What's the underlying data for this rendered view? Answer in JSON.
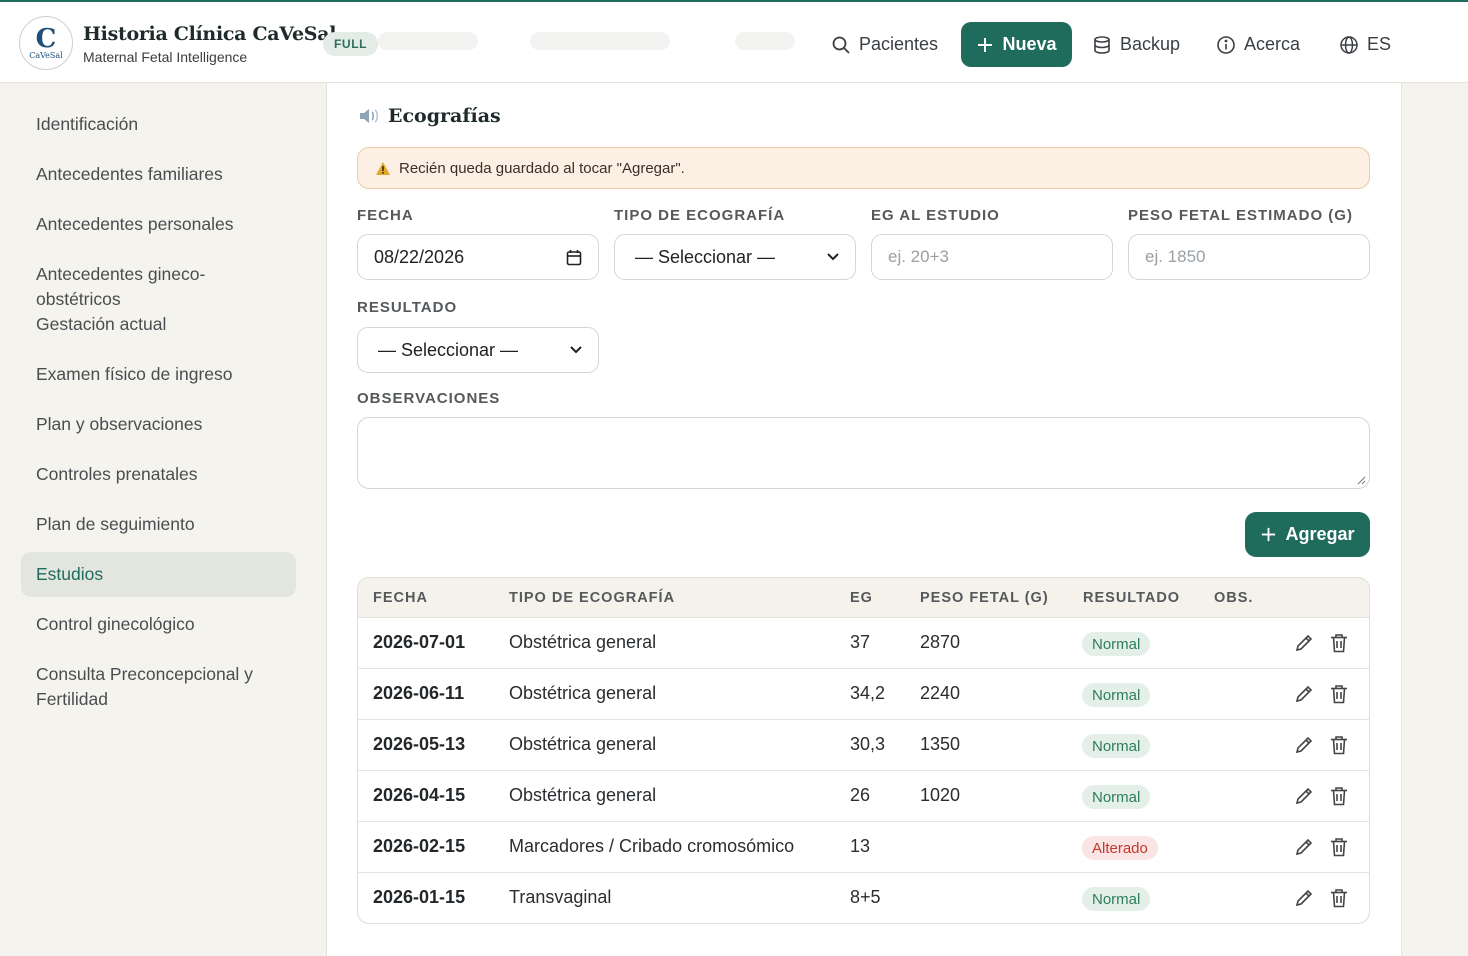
{
  "header": {
    "brand_title": "Historia Clínica CaVeSal",
    "brand_subtitle": "Maternal Fetal Intelligence",
    "logo_mini": "CaVeSal",
    "plan_badge": "FULL",
    "nav": {
      "patients": "Pacientes",
      "new": "Nueva",
      "backup": "Backup",
      "about": "Acerca",
      "language": "ES"
    },
    "accent": "#1f6b5c"
  },
  "sidebar": {
    "items": [
      {
        "label": "Identificación"
      },
      {
        "label": "Antecedentes familiares"
      },
      {
        "label": "Antecedentes personales"
      },
      {
        "label": "Antecedentes gineco-obstétricos"
      },
      {
        "label": "Gestación actual"
      },
      {
        "label": "Examen físico de ingreso"
      },
      {
        "label": "Plan y observaciones"
      },
      {
        "label": "Controles prenatales"
      },
      {
        "label": "Plan de seguimiento"
      },
      {
        "label": "Estudios"
      },
      {
        "label": "Control ginecológico"
      },
      {
        "label": "Consulta Preconcepcional y Fertilidad"
      }
    ],
    "active_label": "Estudios"
  },
  "main": {
    "section_title": "Ecografías",
    "alert_text": "Recién queda guardado al tocar \"Agregar\".",
    "form": {
      "date_label": "FECHA",
      "date_value": "08/22/2026",
      "type_label": "TIPO DE ECOGRAFÍA",
      "type_value": "— Seleccionar —",
      "ga_label": "EG AL ESTUDIO",
      "ga_placeholder": "ej. 20+3",
      "weight_label": "PESO FETAL ESTIMADO (G)",
      "weight_placeholder": "ej. 1850",
      "result_label": "RESULTADO",
      "result_value": "— Seleccionar —",
      "notes_label": "OBSERVACIONES",
      "add_button": "Agregar"
    },
    "table": {
      "headers": {
        "date": "FECHA",
        "type": "TIPO DE ECOGRAFÍA",
        "ga": "EG",
        "weight": "PESO FETAL (G)",
        "result": "RESULTADO",
        "obs": "OBS."
      },
      "rows": [
        {
          "date": "2026-07-01",
          "type": "Obstétrica general",
          "ga": "37",
          "weight": "2870",
          "result": "Normal",
          "status": "ok"
        },
        {
          "date": "2026-06-11",
          "type": "Obstétrica general",
          "ga": "34,2",
          "weight": "2240",
          "result": "Normal",
          "status": "ok"
        },
        {
          "date": "2026-05-13",
          "type": "Obstétrica general",
          "ga": "30,3",
          "weight": "1350",
          "result": "Normal",
          "status": "ok"
        },
        {
          "date": "2026-04-15",
          "type": "Obstétrica general",
          "ga": "26",
          "weight": "1020",
          "result": "Normal",
          "status": "ok"
        },
        {
          "date": "2026-02-15",
          "type": "Marcadores / Cribado cromosómico",
          "ga": "13",
          "weight": "",
          "result": "Alterado",
          "status": "bad"
        },
        {
          "date": "2026-01-15",
          "type": "Transvaginal",
          "ga": "8+5",
          "weight": "",
          "result": "Normal",
          "status": "ok"
        }
      ]
    }
  }
}
